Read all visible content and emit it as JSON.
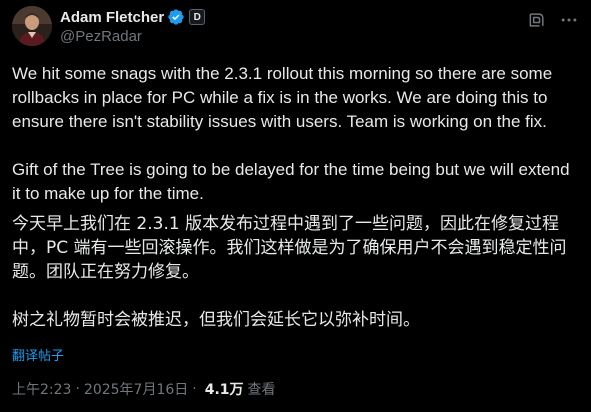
{
  "author": {
    "display_name": "Adam Fletcher",
    "handle": "@PezRadar",
    "affiliate_badge": "D"
  },
  "icons": {
    "avatar": "user-avatar-photo",
    "verified": "verified-badge-icon",
    "affiliate": "affiliate-badge-icon",
    "grok": "grok-icon",
    "more": "more-options-icon"
  },
  "colors": {
    "background": "#000000",
    "text": "#e7e9ea",
    "muted": "#71767b",
    "accent": "#1d9bf0"
  },
  "tweet": {
    "paragraph_1": "We hit some snags with the 2.3.1 rollout this morning so there are some rollbacks in place for PC while a fix is in the works. We are doing this to ensure there isn't stability issues with users. Team is working on the fix.",
    "paragraph_2": "Gift of the Tree is going to be delayed for the time being but we will extend it to make up for the time.",
    "translation_paragraph_1": "今天早上我们在 2.3.1 版本发布过程中遇到了一些问题，因此在修复过程中，PC 端有一些回滚操作。我们这样做是为了确保用户不会遇到稳定性问题。团队正在努力修复。",
    "translation_paragraph_2": "树之礼物暂时会被推迟，但我们会延长它以弥补时间。",
    "translate_link": "翻译帖子"
  },
  "meta": {
    "time": "上午2:23",
    "separator": "·",
    "date": "2025年7月16日",
    "views_count": "4.1万",
    "views_label": "查看"
  }
}
